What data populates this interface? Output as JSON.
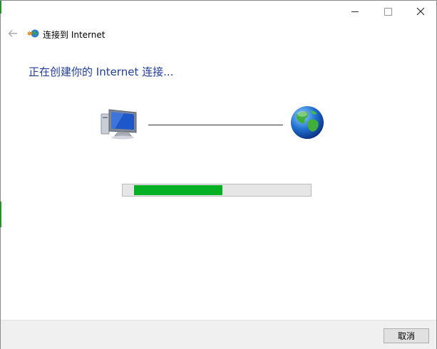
{
  "window": {
    "controls": {
      "minimize_icon": "minimize-icon",
      "maximize_icon": "maximize-icon",
      "close_icon": "close-icon"
    }
  },
  "header": {
    "back_icon": "back-arrow-icon",
    "app_icon": "internet-connection-icon",
    "title": "连接到 Internet"
  },
  "main": {
    "heading": "正在创建你的 Internet 连接...",
    "graphic": {
      "left_icon": "computer-icon",
      "right_icon": "globe-icon"
    },
    "progress": {
      "fraction": 0.5
    }
  },
  "footer": {
    "cancel_label": "取消"
  },
  "colors": {
    "heading": "#1f3d99",
    "progress_fill": "#06b025",
    "progress_track": "#e6e6e6",
    "footer_bg": "#f0f0f0"
  }
}
